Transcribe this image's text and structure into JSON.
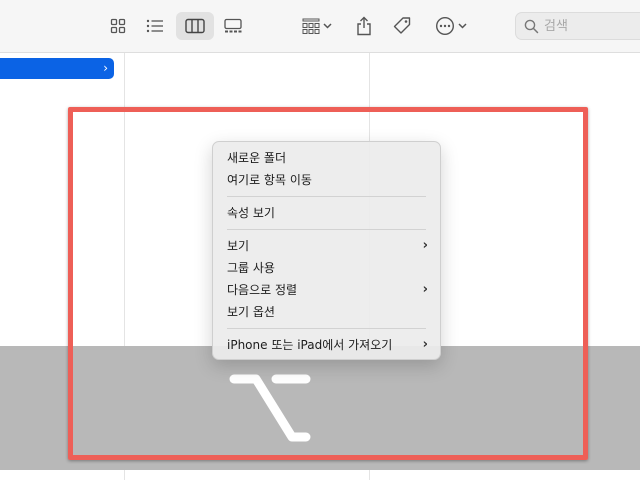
{
  "toolbar": {
    "view_buttons": [
      {
        "name": "icon-view",
        "active": false
      },
      {
        "name": "list-view",
        "active": false
      },
      {
        "name": "column-view",
        "active": true
      },
      {
        "name": "gallery-view",
        "active": false
      }
    ],
    "search": {
      "placeholder": "검색"
    }
  },
  "sidebar_row": {
    "chevron": "›"
  },
  "context_menu": {
    "items": [
      {
        "label": "새로운 폴더",
        "submenu": false
      },
      {
        "label": "여기로 항목 이동",
        "submenu": false
      },
      {
        "separator": true
      },
      {
        "label": "속성 보기",
        "submenu": false
      },
      {
        "separator": true
      },
      {
        "label": "보기",
        "submenu": true
      },
      {
        "label": "그룹 사용",
        "submenu": false
      },
      {
        "label": "다음으로 정렬",
        "submenu": true
      },
      {
        "label": "보기 옵션",
        "submenu": false
      },
      {
        "separator": true
      },
      {
        "label": "iPhone 또는 iPad에서 가져오기",
        "submenu": true
      }
    ],
    "submenu_chevron": "›"
  },
  "overlay": {
    "key_glyph": "option-key-icon"
  },
  "colors": {
    "highlight": "#ee5f57",
    "selection": "#0b63e5",
    "overlay": "#b8b8b8"
  }
}
